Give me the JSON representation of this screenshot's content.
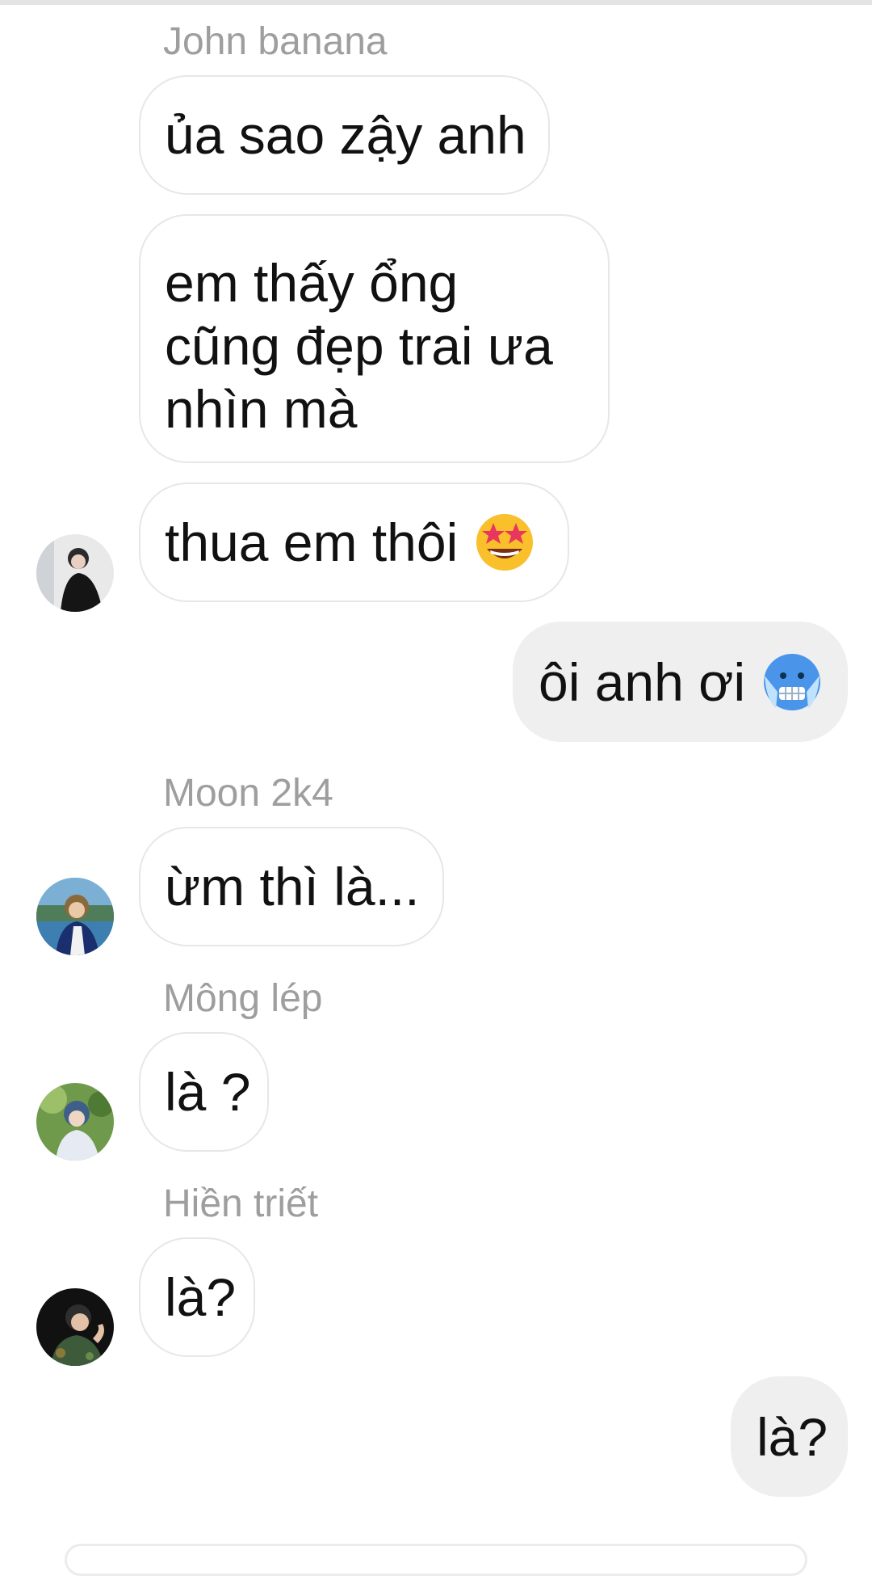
{
  "conversation": [
    {
      "sender": "John banana",
      "messages": [
        "ủa sao zậy anh",
        "em thấy ổng cũng đẹp trai ưa nhìn mà",
        "thua em thôi"
      ],
      "last_emoji": "star-struck-emoji"
    },
    {
      "outgoing": "ôi anh ơi",
      "emoji": "cold-face-emoji"
    },
    {
      "sender": "Moon 2k4",
      "messages": [
        "ừm thì là..."
      ]
    },
    {
      "sender": "Mông lép",
      "messages": [
        "là ?"
      ]
    },
    {
      "sender": "Hiền triết",
      "messages": [
        "là?"
      ]
    },
    {
      "outgoing": "là?"
    }
  ],
  "colors": {
    "incoming_border": "#e7e7e7",
    "outgoing_bg": "#efefef",
    "sender_name": "#9e9e9e",
    "text": "#111111"
  }
}
